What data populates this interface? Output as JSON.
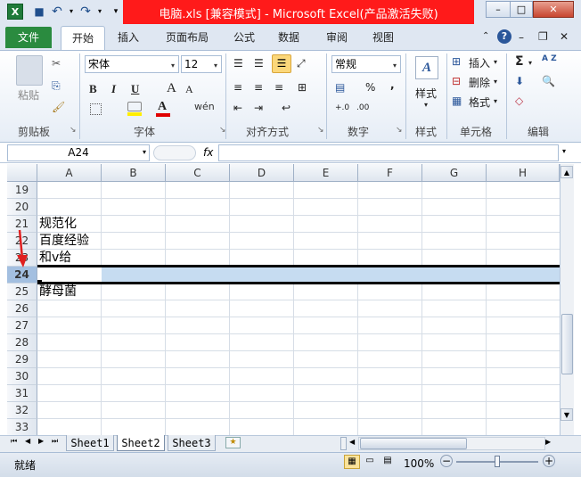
{
  "window": {
    "title": "电脑.xls  [兼容模式]  -  Microsoft Excel(产品激活失败)",
    "app_icon": "X",
    "controls": {
      "minimize": "–",
      "restore": "□",
      "close": "✕"
    },
    "doc_controls": {
      "minimize": "–",
      "restore": "❐",
      "close": "✕"
    }
  },
  "qat": {
    "save": "■",
    "undo": "↶",
    "redo": "↷",
    "customize": "▾"
  },
  "tabs": {
    "file": "文件",
    "home": "开始",
    "insert": "插入",
    "layout": "页面布局",
    "formulas": "公式",
    "data": "数据",
    "review": "审阅",
    "view": "视图"
  },
  "ribbon": {
    "clipboard": {
      "label": "剪贴板",
      "paste": "粘贴",
      "cut": "✂",
      "copy": "⎘",
      "painter": "🖌"
    },
    "font": {
      "label": "字体",
      "name": "宋体",
      "size": "12",
      "bold": "B",
      "italic": "I",
      "underline": "U",
      "grow": "A",
      "shrink": "A",
      "color_a": "A",
      "phonetic": "wén"
    },
    "alignment": {
      "label": "对齐方式"
    },
    "number": {
      "label": "数字",
      "format": "常规",
      "percent": "%",
      "comma": ",",
      "inc": "+.0",
      "dec": ".00"
    },
    "styles": {
      "label": "样式",
      "btn": "样式"
    },
    "cells": {
      "label": "单元格",
      "insert": "插入",
      "delete": "删除",
      "format": "格式"
    },
    "editing": {
      "label": "编辑",
      "sum": "Σ",
      "sort": "A Z",
      "find": "🔍",
      "fill": "⬇",
      "clear": "◇"
    }
  },
  "formula_bar": {
    "name_box": "A24",
    "fx": "fx",
    "value": ""
  },
  "grid": {
    "columns": [
      "A",
      "B",
      "C",
      "D",
      "E",
      "F",
      "G",
      "H"
    ],
    "rows": [
      "19",
      "20",
      "21",
      "22",
      "23",
      "24",
      "25",
      "26",
      "27",
      "28",
      "29",
      "30",
      "31",
      "32",
      "33"
    ],
    "cells": {
      "A21": "规范化",
      "A22": "百度经验",
      "A23": "和v给",
      "A25": "酵母菌"
    },
    "selected_row": "24"
  },
  "sheets": {
    "tabs": [
      "Sheet1",
      "Sheet2",
      "Sheet3"
    ],
    "active": "Sheet2",
    "nav": [
      "⏮",
      "◀",
      "▶",
      "⏭"
    ]
  },
  "status": {
    "ready": "就绪",
    "zoom": "100%",
    "zoom_minus": "−",
    "zoom_plus": "+"
  },
  "colors": {
    "title_red": "#ff1a1a",
    "file_tab": "#2a8b3f",
    "selection": "#c6dcf1",
    "accent": "#2b579a"
  }
}
